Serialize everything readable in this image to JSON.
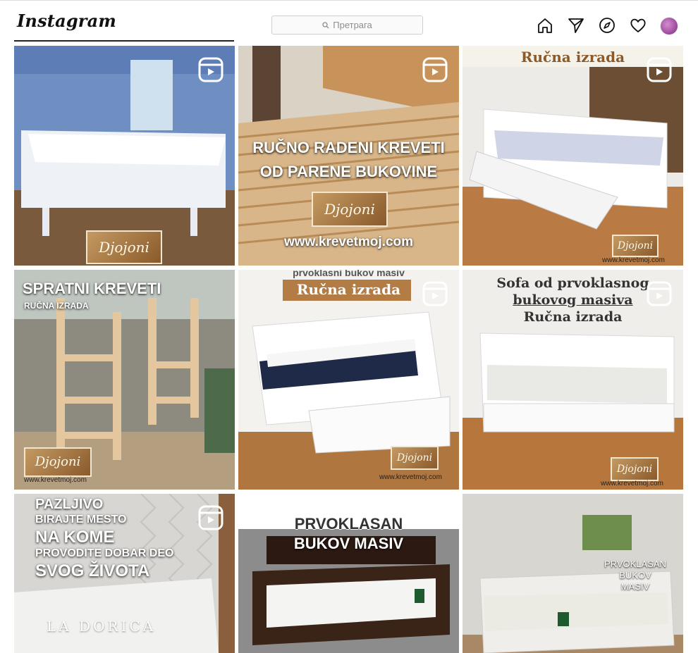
{
  "header": {
    "logo": "Instagram",
    "search_placeholder": "Претрага",
    "icons": [
      "home-icon",
      "direct-icon",
      "explore-icon",
      "heart-icon",
      "avatar"
    ]
  },
  "posts": [
    {
      "caption_lines": [],
      "brand": "Djojoni",
      "url": "",
      "reel": true
    },
    {
      "caption_lines": [
        "RUČNO RADENI KREVETI",
        "OD PARENE BUKOVINE"
      ],
      "brand": "Djojoni",
      "url": "www.krevetmoj.com",
      "reel": true
    },
    {
      "caption_lines": [
        "Ručna izrada"
      ],
      "brand": "Djojoni",
      "url": "www.krevetmoj.com",
      "reel": true
    },
    {
      "caption_lines": [
        "SPRATNI KREVETI",
        "RUČNA IZRADA"
      ],
      "brand": "Djojoni",
      "url": "www.krevetmoj.com",
      "reel": false
    },
    {
      "caption_lines": [
        "prvoklasni bukov masiv",
        "Ručna izrada"
      ],
      "brand": "Djojoni",
      "url": "www.krevetmoj.com",
      "reel": true
    },
    {
      "caption_lines": [
        "Sofa od prvoklasnog",
        "bukovog masiva",
        "Ručna izrada"
      ],
      "brand": "Djojoni",
      "url": "www.krevetmoj.com",
      "reel": true
    },
    {
      "caption_lines": [
        "PAZLJIVO",
        "BIRAJTE MESTO",
        "NA KOME",
        "PROVODITE DOBAR DEO",
        "SVOG ŽIVOTA"
      ],
      "brand": "LA DORICA",
      "url": "",
      "reel": true
    },
    {
      "caption_lines": [
        "PRVOKLASAN",
        "BUKOV MASIV"
      ],
      "brand": "",
      "url": "",
      "reel": false
    },
    {
      "caption_lines": [
        "PRVOKLASAN",
        "BUKOV",
        "MASIV"
      ],
      "brand": "",
      "url": "",
      "reel": false
    }
  ],
  "colors": {
    "brand_wood": "#a87a44",
    "caption_bar": "#b27c44"
  }
}
